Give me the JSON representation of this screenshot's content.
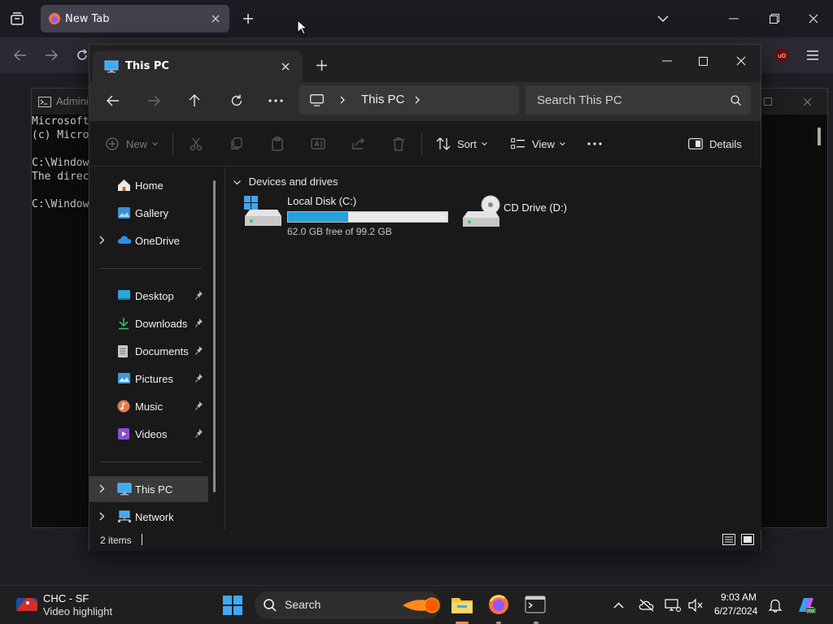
{
  "browser": {
    "tab_label": "New Tab"
  },
  "cmd": {
    "title": "Admini",
    "lines": [
      "Microsoft",
      "(c) Micro",
      "",
      "C:\\Window",
      "The direc",
      "",
      "C:\\Window"
    ]
  },
  "explorer": {
    "tab_title": "This PC",
    "breadcrumb": "This PC",
    "search_placeholder": "Search This PC",
    "toolbar": {
      "new_label": "New",
      "sort_label": "Sort",
      "view_label": "View",
      "details_label": "Details"
    },
    "sidebar": {
      "top": [
        {
          "label": "Home",
          "icon": "home-icon"
        },
        {
          "label": "Gallery",
          "icon": "gallery-icon"
        },
        {
          "label": "OneDrive",
          "icon": "onedrive-icon"
        }
      ],
      "quick": [
        {
          "label": "Desktop",
          "icon": "desktop-folder-icon"
        },
        {
          "label": "Downloads",
          "icon": "downloads-icon"
        },
        {
          "label": "Documents",
          "icon": "documents-icon"
        },
        {
          "label": "Pictures",
          "icon": "pictures-icon"
        },
        {
          "label": "Music",
          "icon": "music-icon"
        },
        {
          "label": "Videos",
          "icon": "videos-icon"
        }
      ],
      "bottom": [
        {
          "label": "This PC",
          "icon": "this-pc-icon"
        },
        {
          "label": "Network",
          "icon": "network-icon"
        }
      ]
    },
    "group_label": "Devices and drives",
    "drives": [
      {
        "name": "Local Disk (C:)",
        "free_text": "62.0 GB free of 99.2 GB",
        "used_fraction": 0.375
      },
      {
        "name": "CD Drive (D:)"
      }
    ],
    "status": {
      "items": "2 items"
    }
  },
  "taskbar": {
    "weather_title": "CHC - SF",
    "weather_sub": "Video highlight",
    "search_label": "Search",
    "time": "9:03 AM",
    "date": "6/27/2024"
  },
  "colors": {
    "accent": "#26a0da",
    "selection": "#3a3a3a",
    "window_bg": "#191919"
  }
}
